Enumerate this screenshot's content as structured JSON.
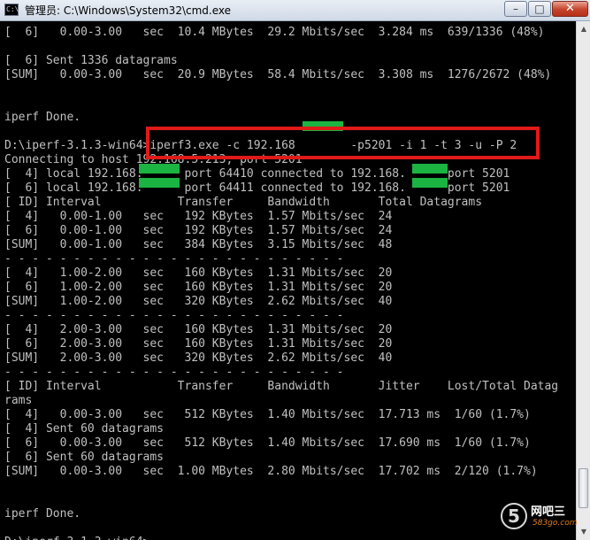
{
  "window": {
    "title": "管理员: C:\\Windows\\System32\\cmd.exe",
    "icon": "cmd-icon",
    "icon_glyph": "C:\\",
    "minimize_glyph": "–",
    "maximize_glyph": "□",
    "close_glyph": "✕"
  },
  "console": {
    "text_color": "#c0c0c0",
    "background": "#000000",
    "lines": [
      "[  6]   0.00-3.00   sec  10.4 MBytes  29.2 Mbits/sec  3.284 ms  639/1336 (48%)",
      "",
      "[  6] Sent 1336 datagrams",
      "[SUM]   0.00-3.00   sec  20.9 MBytes  58.4 Mbits/sec  3.308 ms  1276/2672 (48%)",
      "",
      "",
      "iperf Done.",
      "",
      "D:\\iperf-3.1.3-win64>iperf3.exe -c 192.168        -p5201 -i 1 -t 3 -u -P 2",
      "Connecting to host 192.168.5.213, port 5201",
      "[  4] local 192.168.      port 64410 connected to 192.168.      port 5201",
      "[  6] local 192.168.      port 64411 connected to 192.168.      port 5201",
      "[ ID] Interval           Transfer     Bandwidth       Total Datagrams",
      "[  4]   0.00-1.00   sec   192 KBytes  1.57 Mbits/sec  24",
      "[  6]   0.00-1.00   sec   192 KBytes  1.57 Mbits/sec  24",
      "[SUM]   0.00-1.00   sec   384 KBytes  3.15 Mbits/sec  48",
      "- - - - - - - - - - - - - - - - - - - - - - - - -",
      "[  4]   1.00-2.00   sec   160 KBytes  1.31 Mbits/sec  20",
      "[  6]   1.00-2.00   sec   160 KBytes  1.31 Mbits/sec  20",
      "[SUM]   1.00-2.00   sec   320 KBytes  2.62 Mbits/sec  40",
      "- - - - - - - - - - - - - - - - - - - - - - - - -",
      "[  4]   2.00-3.00   sec   160 KBytes  1.31 Mbits/sec  20",
      "[  6]   2.00-3.00   sec   160 KBytes  1.31 Mbits/sec  20",
      "[SUM]   2.00-3.00   sec   320 KBytes  2.62 Mbits/sec  40",
      "- - - - - - - - - - - - - - - - - - - - - - - - -",
      "[ ID] Interval           Transfer     Bandwidth       Jitter    Lost/Total Datag",
      "rams",
      "[  4]   0.00-3.00   sec   512 KBytes  1.40 Mbits/sec  17.713 ms  1/60 (1.7%)",
      "[  4] Sent 60 datagrams",
      "[  6]   0.00-3.00   sec   512 KBytes  1.40 Mbits/sec  17.690 ms  1/60 (1.7%)",
      "[  6] Sent 60 datagrams",
      "[SUM]   0.00-3.00   sec  1.00 MBytes  2.80 Mbits/sec  17.702 ms  2/120 (1.7%)",
      "",
      "",
      "iperf Done.",
      "",
      "D:\\iperf-3.1.3-win64>"
    ]
  },
  "scrollbar": {
    "up_glyph": "▲",
    "down_glyph": "▼"
  },
  "watermark": {
    "logo": "5",
    "name": "网吧三",
    "site": "583go.com"
  },
  "colors": {
    "highlight_box": "#e01919",
    "redaction": "#1bb342"
  }
}
